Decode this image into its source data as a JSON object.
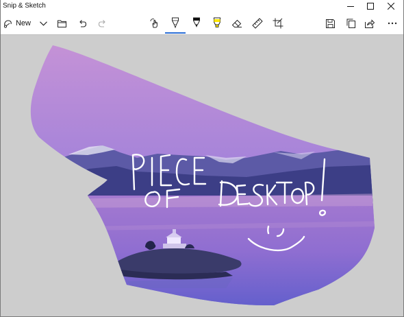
{
  "window": {
    "title": "Snip & Sketch"
  },
  "toolbar": {
    "new_label": "New",
    "left_buttons": [
      {
        "name": "new-snip",
        "icon": "snip-icon",
        "label": "New"
      },
      {
        "name": "new-snip-options",
        "icon": "chevron-down-icon"
      },
      {
        "name": "open-file",
        "icon": "folder-icon"
      },
      {
        "name": "undo",
        "icon": "undo-icon"
      },
      {
        "name": "redo",
        "icon": "redo-icon",
        "state": "disabled"
      }
    ],
    "center_tools": [
      {
        "name": "touch-writing",
        "icon": "touch-writing-icon"
      },
      {
        "name": "ballpoint-pen",
        "icon": "ballpoint-pen-icon",
        "selected": true,
        "color": "#ffffff"
      },
      {
        "name": "pencil",
        "icon": "pencil-icon",
        "color": "#000000"
      },
      {
        "name": "highlighter",
        "icon": "highlighter-icon",
        "color": "#ffe600"
      },
      {
        "name": "eraser",
        "icon": "eraser-icon"
      },
      {
        "name": "ruler",
        "icon": "ruler-icon"
      },
      {
        "name": "crop",
        "icon": "crop-icon"
      }
    ],
    "right_buttons": [
      {
        "name": "save",
        "icon": "save-icon"
      },
      {
        "name": "copy",
        "icon": "copy-icon"
      },
      {
        "name": "share",
        "icon": "share-icon"
      },
      {
        "name": "see-more",
        "icon": "more-icon"
      }
    ]
  },
  "canvas": {
    "background": "#cdcdcd",
    "snip_shape": "freeform",
    "snip_content": "lake-landscape-at-dusk",
    "ink_color": "#ffffff",
    "handwritten_text": [
      "PIECE",
      "OF DESKTOP",
      "!"
    ],
    "drawn_face": "smiley"
  },
  "colors": {
    "accent": "#2b6ed6",
    "sky_top": "#c793d6",
    "sky_bottom": "#6f74d6",
    "water": "#8f6ed1"
  }
}
